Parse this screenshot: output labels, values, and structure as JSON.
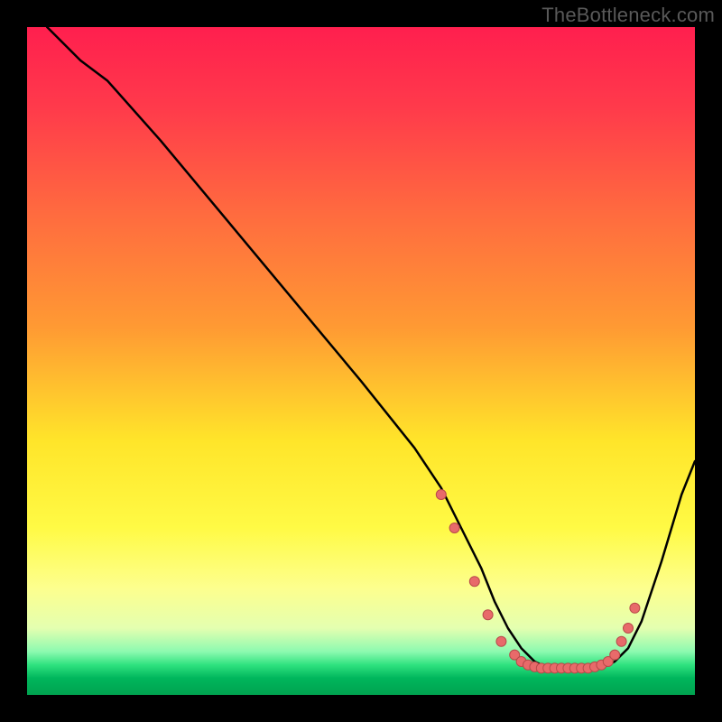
{
  "watermark": "TheBottleneck.com",
  "colors": {
    "bg": "#000000",
    "watermark": "#595959",
    "curve": "#000000",
    "marker_fill": "#e86a6a",
    "marker_stroke": "#b84a4a",
    "gradient_stops": [
      {
        "pos": 0.0,
        "color": "#ff1f4e"
      },
      {
        "pos": 0.12,
        "color": "#ff3a4b"
      },
      {
        "pos": 0.28,
        "color": "#ff6b3f"
      },
      {
        "pos": 0.45,
        "color": "#ff9a33"
      },
      {
        "pos": 0.62,
        "color": "#ffe52a"
      },
      {
        "pos": 0.75,
        "color": "#fffa45"
      },
      {
        "pos": 0.84,
        "color": "#fdff8e"
      },
      {
        "pos": 0.9,
        "color": "#e4ffb0"
      },
      {
        "pos": 0.935,
        "color": "#8dfab0"
      },
      {
        "pos": 0.955,
        "color": "#2fe27f"
      },
      {
        "pos": 0.975,
        "color": "#00b65c"
      },
      {
        "pos": 1.0,
        "color": "#00a24f"
      }
    ]
  },
  "chart_data": {
    "type": "line",
    "title": "",
    "xlabel": "",
    "ylabel": "",
    "xlim": [
      0,
      100
    ],
    "ylim": [
      0,
      100
    ],
    "series": [
      {
        "name": "bottleneck-curve",
        "x": [
          3,
          8,
          12,
          20,
          30,
          40,
          50,
          58,
          62,
          65,
          68,
          70,
          72,
          74,
          76,
          78,
          80,
          82,
          84,
          86,
          88,
          90,
          92,
          95,
          98,
          100
        ],
        "y": [
          100,
          95,
          92,
          83,
          71,
          59,
          47,
          37,
          31,
          25,
          19,
          14,
          10,
          7,
          5,
          4,
          4,
          4,
          4,
          4,
          5,
          7,
          11,
          20,
          30,
          35
        ]
      }
    ],
    "markers": {
      "name": "marker-dots",
      "x": [
        62,
        64,
        67,
        69,
        71,
        73,
        74,
        75,
        76,
        77,
        78,
        79,
        80,
        81,
        82,
        83,
        84,
        85,
        86,
        87,
        88,
        89,
        90,
        91
      ],
      "y": [
        30,
        25,
        17,
        12,
        8,
        6,
        5,
        4.5,
        4.2,
        4,
        4,
        4,
        4,
        4,
        4,
        4,
        4,
        4.2,
        4.5,
        5,
        6,
        8,
        10,
        13
      ]
    }
  }
}
